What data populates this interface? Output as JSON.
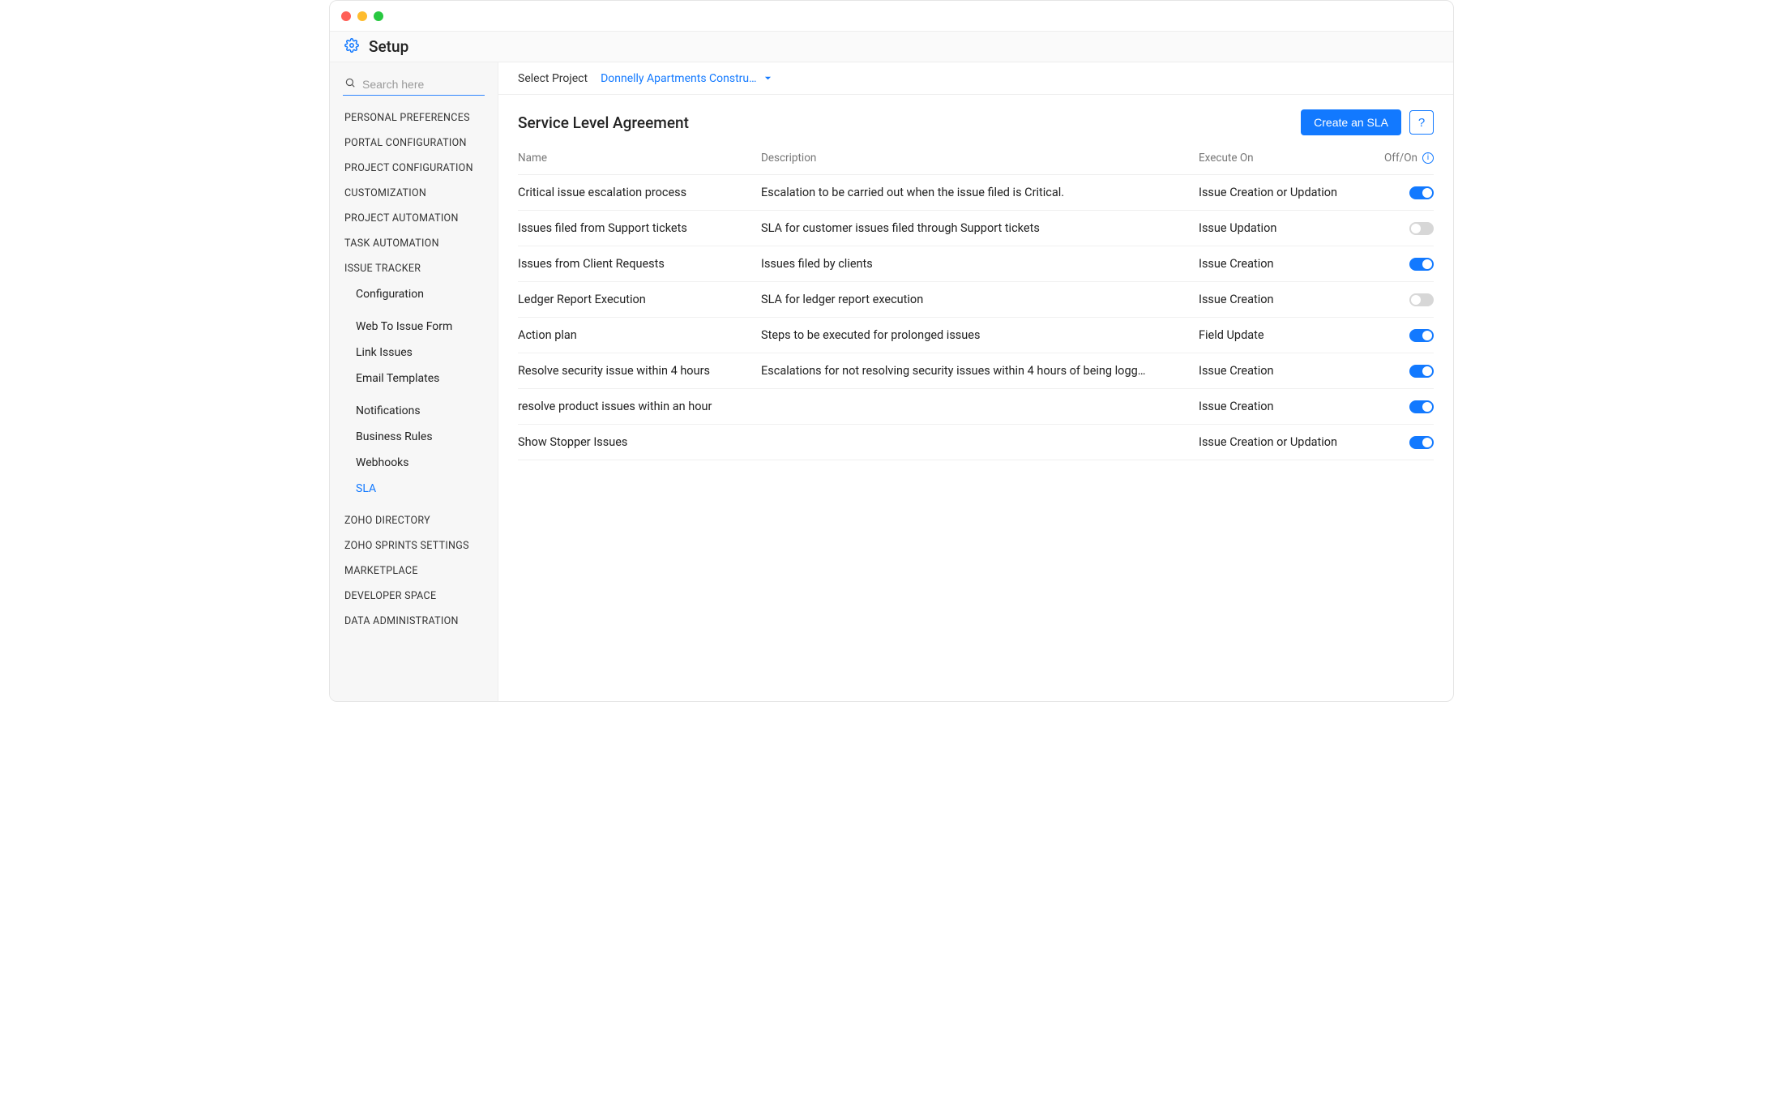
{
  "app": {
    "title": "Setup"
  },
  "sidebar": {
    "search_placeholder": "Search here",
    "sections": [
      {
        "label": "PERSONAL PREFERENCES"
      },
      {
        "label": "PORTAL CONFIGURATION"
      },
      {
        "label": "PROJECT CONFIGURATION"
      },
      {
        "label": "CUSTOMIZATION"
      },
      {
        "label": "PROJECT AUTOMATION"
      },
      {
        "label": "TASK AUTOMATION"
      },
      {
        "label": "ISSUE TRACKER",
        "children": [
          {
            "label": "Configuration"
          },
          {
            "label": "Web To Issue Form"
          },
          {
            "label": "Link Issues"
          },
          {
            "label": "Email Templates"
          },
          {
            "label": "Notifications"
          },
          {
            "label": "Business Rules"
          },
          {
            "label": "Webhooks"
          },
          {
            "label": "SLA",
            "active": true
          }
        ]
      },
      {
        "label": "ZOHO DIRECTORY"
      },
      {
        "label": "ZOHO SPRINTS SETTINGS"
      },
      {
        "label": "MARKETPLACE"
      },
      {
        "label": "DEVELOPER SPACE"
      },
      {
        "label": "DATA ADMINISTRATION"
      }
    ]
  },
  "project": {
    "label": "Select Project",
    "value": "Donnelly Apartments Constru…"
  },
  "page": {
    "title": "Service Level Agreement",
    "create_label": "Create an SLA",
    "help_label": "?"
  },
  "table": {
    "headers": {
      "name": "Name",
      "description": "Description",
      "execute_on": "Execute On",
      "off_on": "Off/On"
    },
    "rows": [
      {
        "name": "Critical issue escalation process",
        "description": "Escalation to be carried out when the issue filed is Critical.",
        "execute_on": "Issue Creation or Updation",
        "on": true
      },
      {
        "name": "Issues filed from Support tickets",
        "description": "SLA for customer issues filed through Support tickets",
        "execute_on": "Issue Updation",
        "on": false
      },
      {
        "name": "Issues from Client Requests",
        "description": "Issues filed by clients",
        "execute_on": "Issue Creation",
        "on": true
      },
      {
        "name": "Ledger Report Execution",
        "description": "SLA for ledger report execution",
        "execute_on": "Issue Creation",
        "on": false
      },
      {
        "name": "Action plan",
        "description": "Steps to be executed for prolonged issues",
        "execute_on": "Field Update",
        "on": true
      },
      {
        "name": "Resolve security issue within 4 hours",
        "description": "Escalations for not resolving security issues within 4 hours of being logg…",
        "execute_on": "Issue Creation",
        "on": true
      },
      {
        "name": "resolve product issues within an hour",
        "description": "",
        "execute_on": "Issue Creation",
        "on": true
      },
      {
        "name": "Show Stopper Issues",
        "description": "",
        "execute_on": "Issue Creation or Updation",
        "on": true
      }
    ]
  }
}
